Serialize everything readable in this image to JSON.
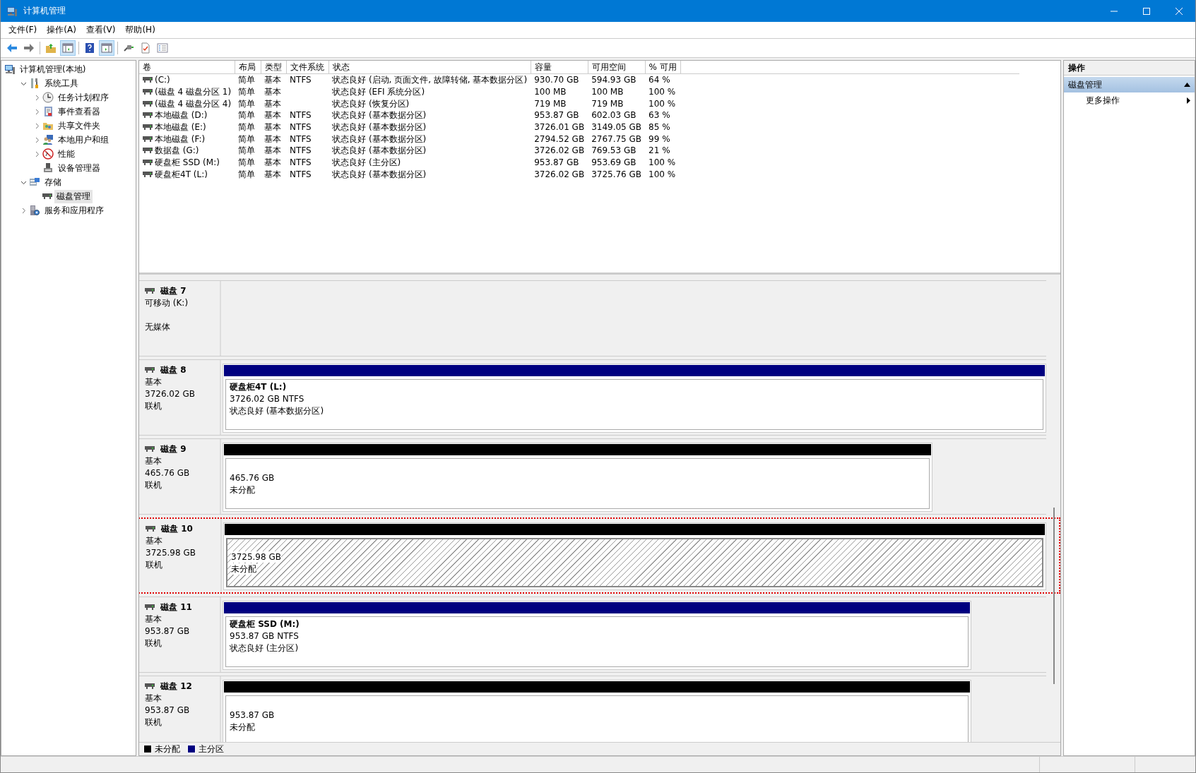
{
  "window": {
    "title": "计算机管理"
  },
  "menu": [
    "文件(F)",
    "操作(A)",
    "查看(V)",
    "帮助(H)"
  ],
  "toolbar": [
    {
      "pressed": false
    },
    {
      "pressed": false
    },
    {
      "pressed": false
    },
    {
      "pressed": true
    },
    {
      "pressed": false
    },
    {
      "pressed": true
    },
    {
      "pressed": false
    },
    {
      "pressed": false
    },
    {
      "pressed": false
    }
  ],
  "tree": [
    {
      "label": "计算机管理(本地)",
      "selected": false,
      "children": [
        {
          "label": "系统工具",
          "expanded": true,
          "selected": false,
          "children": [
            {
              "label": "任务计划程序",
              "expanded": false,
              "selected": false
            },
            {
              "label": "事件查看器",
              "expanded": false,
              "selected": false
            },
            {
              "label": "共享文件夹",
              "expanded": false,
              "selected": false
            },
            {
              "label": "本地用户和组",
              "expanded": false,
              "selected": false
            },
            {
              "label": "性能",
              "expanded": false,
              "selected": false
            },
            {
              "label": "设备管理器",
              "selected": false
            }
          ]
        },
        {
          "label": "存储",
          "expanded": true,
          "selected": false,
          "children": [
            {
              "label": "磁盘管理",
              "selected": true
            }
          ]
        },
        {
          "label": "服务和应用程序",
          "expanded": false,
          "selected": false
        }
      ]
    }
  ],
  "volumes": {
    "columns": [
      "卷",
      "布局",
      "类型",
      "文件系统",
      "状态",
      "容量",
      "可用空间",
      "% 可用"
    ],
    "rows": [
      {
        "volume": "(C:)",
        "layout": "简单",
        "type": "基本",
        "file_system": "NTFS",
        "status": "状态良好 (启动, 页面文件, 故障转储, 基本数据分区)",
        "capacity": "930.70 GB",
        "free_space": "594.93 GB",
        "percent_free": "64 %"
      },
      {
        "volume": "(磁盘 4 磁盘分区 1)",
        "layout": "简单",
        "type": "基本",
        "status": "状态良好 (EFI 系统分区)",
        "capacity": "100 MB",
        "free_space": "100 MB",
        "percent_free": "100 %"
      },
      {
        "volume": "(磁盘 4 磁盘分区 4)",
        "layout": "简单",
        "type": "基本",
        "status": "状态良好 (恢复分区)",
        "capacity": "719 MB",
        "free_space": "719 MB",
        "percent_free": "100 %"
      },
      {
        "volume": "本地磁盘 (D:)",
        "layout": "简单",
        "type": "基本",
        "file_system": "NTFS",
        "status": "状态良好 (基本数据分区)",
        "capacity": "953.87 GB",
        "free_space": "602.03 GB",
        "percent_free": "63 %"
      },
      {
        "volume": "本地磁盘 (E:)",
        "layout": "简单",
        "type": "基本",
        "file_system": "NTFS",
        "status": "状态良好 (基本数据分区)",
        "capacity": "3726.01 GB",
        "free_space": "3149.05 GB",
        "percent_free": "85 %"
      },
      {
        "volume": "本地磁盘 (F:)",
        "layout": "简单",
        "type": "基本",
        "file_system": "NTFS",
        "status": "状态良好 (基本数据分区)",
        "capacity": "2794.52 GB",
        "free_space": "2767.75 GB",
        "percent_free": "99 %"
      },
      {
        "volume": "数据盘 (G:)",
        "layout": "简单",
        "type": "基本",
        "file_system": "NTFS",
        "status": "状态良好 (基本数据分区)",
        "capacity": "3726.02 GB",
        "free_space": "769.53 GB",
        "percent_free": "21 %"
      },
      {
        "volume": "硬盘柜 SSD (M:)",
        "layout": "简单",
        "type": "基本",
        "file_system": "NTFS",
        "status": "状态良好 (主分区)",
        "capacity": "953.87 GB",
        "free_space": "953.69 GB",
        "percent_free": "100 %"
      },
      {
        "volume": "硬盘柜4T (L:)",
        "layout": "简单",
        "type": "基本",
        "file_system": "NTFS",
        "status": "状态良好 (基本数据分区)",
        "capacity": "3726.02 GB",
        "free_space": "3725.76 GB",
        "percent_free": "100 %"
      }
    ]
  },
  "disks": [
    {
      "kind": "removable",
      "name": "磁盘 7",
      "type": "可移动 (K:)",
      "status": "无媒体",
      "selected": false
    },
    {
      "kind": "basic",
      "name": "磁盘 8",
      "type": "基本",
      "size": "3726.02 GB",
      "status": "联机",
      "selected": false,
      "partitions": [
        {
          "kind": "primary",
          "label": "硬盘柜4T  (L:)",
          "size": "3726.02 GB NTFS",
          "status": "状态良好 (基本数据分区)",
          "selected": false
        }
      ]
    },
    {
      "kind": "basic",
      "name": "磁盘 9",
      "type": "基本",
      "size": "465.76 GB",
      "status": "联机",
      "selected": false,
      "partitions": [
        {
          "kind": "unallocated",
          "size": "465.76 GB",
          "status": "未分配",
          "selected": false
        }
      ]
    },
    {
      "kind": "basic",
      "name": "磁盘 10",
      "type": "基本",
      "size": "3725.98 GB",
      "status": "联机",
      "selected": true,
      "partitions": [
        {
          "kind": "unallocated",
          "size": "3725.98 GB",
          "status": "未分配",
          "selected": true
        }
      ]
    },
    {
      "kind": "basic",
      "name": "磁盘 11",
      "type": "基本",
      "size": "953.87 GB",
      "status": "联机",
      "selected": false,
      "partitions": [
        {
          "kind": "primary",
          "label": "硬盘柜 SSD  (M:)",
          "size": "953.87 GB NTFS",
          "status": "状态良好 (主分区)",
          "selected": false
        }
      ]
    },
    {
      "kind": "basic",
      "name": "磁盘 12",
      "type": "基本",
      "size": "953.87 GB",
      "status": "联机",
      "selected": false,
      "partitions": [
        {
          "kind": "unallocated",
          "size": "953.87 GB",
          "status": "未分配",
          "selected": false
        }
      ]
    }
  ],
  "legend": [
    {
      "label": "未分配",
      "color": "#000000"
    },
    {
      "label": "主分区",
      "color": "#000080"
    }
  ],
  "actions": {
    "title": "操作",
    "sections": [
      {
        "label": "磁盘管理",
        "expanded": true,
        "items": [
          {
            "label": "更多操作"
          }
        ]
      }
    ]
  }
}
